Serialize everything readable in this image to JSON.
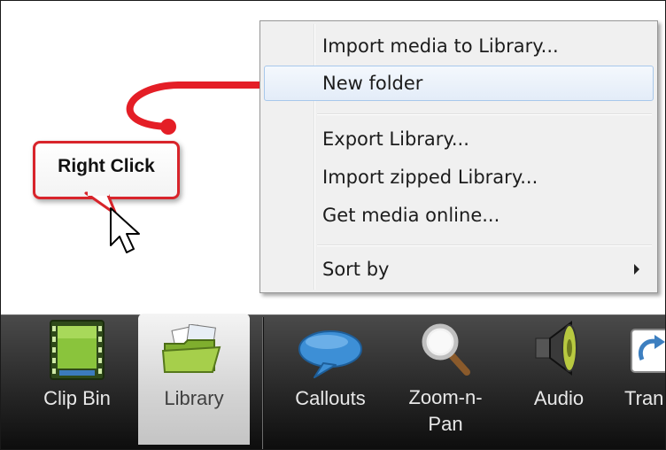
{
  "context_menu": {
    "items": [
      {
        "label": "Import media to Library..."
      },
      {
        "label": "New folder"
      },
      {
        "label": "Export Library..."
      },
      {
        "label": "Import zipped Library..."
      },
      {
        "label": "Get media online..."
      },
      {
        "label": "Sort by"
      }
    ]
  },
  "callout": {
    "text": "Right Click"
  },
  "toolbar": {
    "tools": [
      {
        "label": "Clip Bin",
        "icon": "film-strip-icon"
      },
      {
        "label": "Library",
        "icon": "folder-icon"
      },
      {
        "label": "Callouts",
        "icon": "speech-bubble-icon"
      },
      {
        "label": "Zoom-n-Pan",
        "icon": "magnifier-icon"
      },
      {
        "label": "Audio",
        "icon": "speaker-icon"
      },
      {
        "label": "Tran",
        "icon": "transition-icon"
      }
    ]
  },
  "colors": {
    "arrow": "#e41e26",
    "highlight_border": "#a8c8eb",
    "toolbar_top": "#4a4a4a"
  }
}
